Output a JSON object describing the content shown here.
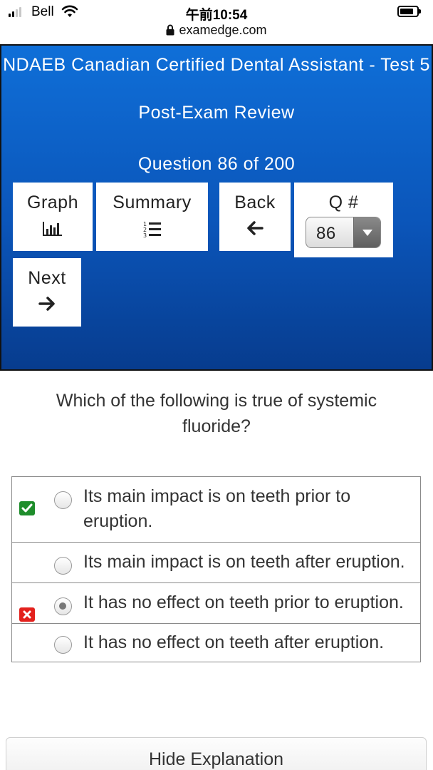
{
  "status_bar": {
    "carrier": "Bell",
    "time": "午前10:54",
    "icons": [
      "signal-icon",
      "wifi-icon",
      "battery-icon"
    ]
  },
  "browser": {
    "url": "examedge.com",
    "icon": "lock-icon"
  },
  "header": {
    "title": "NDAEB Canadian Certified Dental Assistant - Test 5",
    "subtitle": "Post-Exam Review",
    "question_counter": "Question 86 of 200"
  },
  "nav": {
    "graph": {
      "label": "Graph",
      "icon": "bar-chart-icon"
    },
    "summary": {
      "label": "Summary",
      "icon": "numbered-list-icon"
    },
    "back": {
      "label": "Back",
      "icon": "arrow-left-icon"
    },
    "qnum": {
      "label": "Q #",
      "selected": "86"
    },
    "next": {
      "label": "Next",
      "icon": "arrow-right-icon"
    }
  },
  "question": {
    "text": "Which of the following is true of systemic fluoride?"
  },
  "answers": [
    {
      "text": "Its main impact is on teeth prior to eruption.",
      "selected": false,
      "status": "correct"
    },
    {
      "text": "Its main impact is on teeth after eruption.",
      "selected": false,
      "status": ""
    },
    {
      "text": "It has no effect on teeth prior to eruption.",
      "selected": true,
      "status": "incorrect"
    },
    {
      "text": "It has no effect on teeth after eruption.",
      "selected": false,
      "status": ""
    }
  ],
  "colors": {
    "header_blue": "#0b55b9",
    "correct_green": "#1e8d2b",
    "incorrect_red": "#e3211d"
  },
  "explanation_button": {
    "label": "Hide Explanation"
  }
}
